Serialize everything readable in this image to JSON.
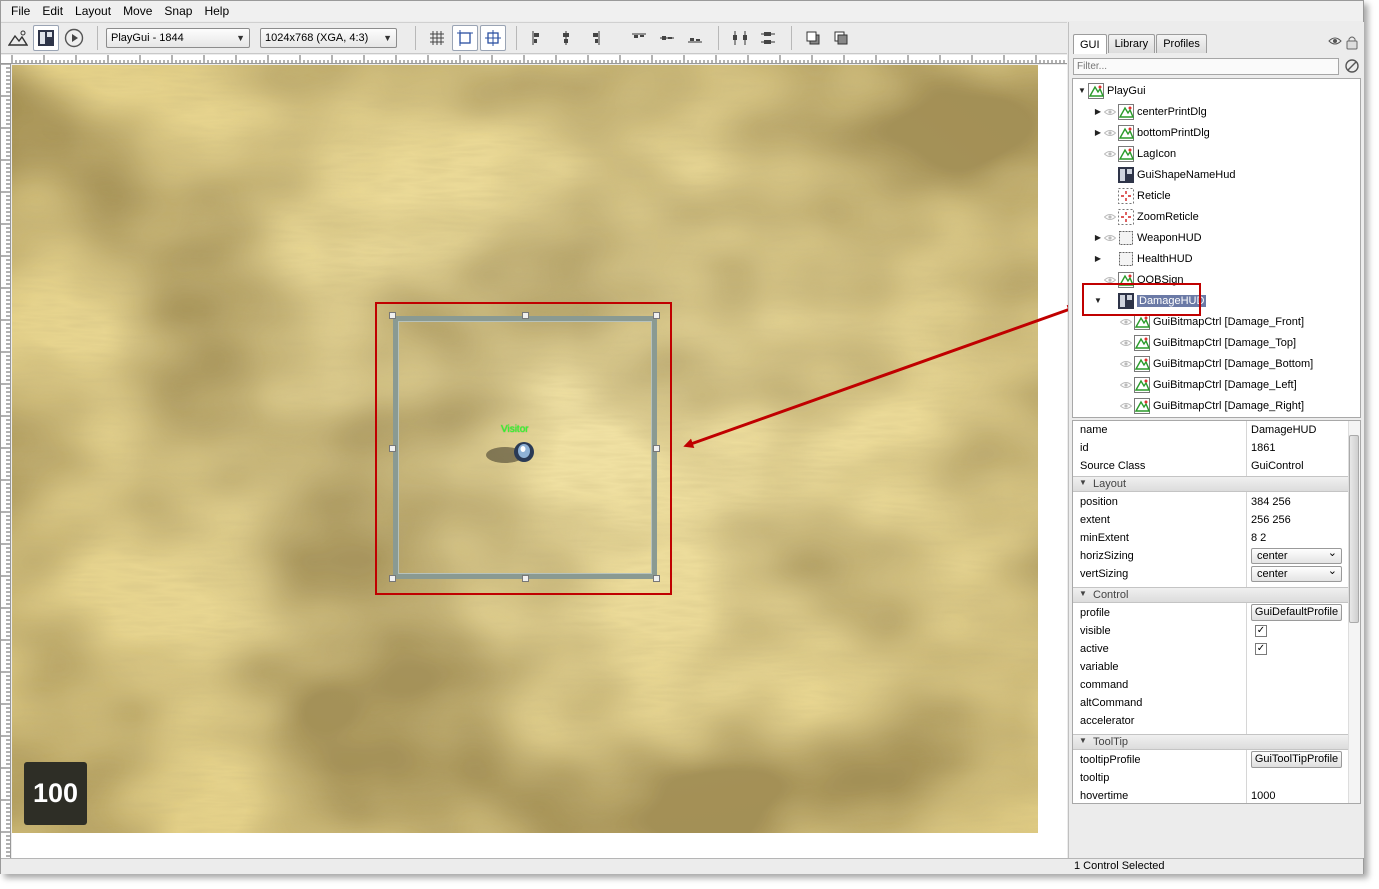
{
  "menubar": {
    "items": [
      "File",
      "Edit",
      "Layout",
      "Move",
      "Snap",
      "Help"
    ]
  },
  "toolbar": {
    "gui_select": "PlayGui - 1844",
    "resolution_select": "1024x768 (XGA, 4:3)"
  },
  "canvas": {
    "object_label": "Visitor",
    "counter": "100"
  },
  "side_panel": {
    "tabs": [
      "GUI",
      "Library",
      "Profiles"
    ],
    "filter_placeholder": "Filter..."
  },
  "tree": [
    {
      "label": "PlayGui",
      "icon": "bitmap-icon",
      "depth": 0,
      "expander": "open",
      "eye": false
    },
    {
      "label": "centerPrintDlg",
      "icon": "bitmap-icon",
      "depth": 1,
      "expander": "closed",
      "eye": true
    },
    {
      "label": "bottomPrintDlg",
      "icon": "bitmap-icon",
      "depth": 1,
      "expander": "closed",
      "eye": true
    },
    {
      "label": "LagIcon",
      "icon": "bitmap-icon",
      "depth": 1,
      "expander": "none",
      "eye": true
    },
    {
      "label": "GuiShapeNameHud",
      "icon": "container-icon",
      "depth": 1,
      "expander": "none",
      "eye": false
    },
    {
      "label": "Reticle",
      "icon": "crosshair-icon",
      "depth": 1,
      "expander": "none",
      "eye": false
    },
    {
      "label": "ZoomReticle",
      "icon": "crosshair-icon",
      "depth": 1,
      "expander": "none",
      "eye": true
    },
    {
      "label": "WeaponHUD",
      "icon": "frame-icon",
      "depth": 1,
      "expander": "closed",
      "eye": true
    },
    {
      "label": "HealthHUD",
      "icon": "frame-icon",
      "depth": 1,
      "expander": "closed",
      "eye": false
    },
    {
      "label": "OOBSign",
      "icon": "bitmap-icon",
      "depth": 1,
      "expander": "none",
      "eye": true
    },
    {
      "label": "DamageHUD",
      "icon": "container-icon",
      "depth": 1,
      "expander": "open",
      "eye": false,
      "selected": true
    },
    {
      "label": "GuiBitmapCtrl [Damage_Front]",
      "icon": "bitmap-icon",
      "depth": 2,
      "expander": "none",
      "eye": true
    },
    {
      "label": "GuiBitmapCtrl [Damage_Top]",
      "icon": "bitmap-icon",
      "depth": 2,
      "expander": "none",
      "eye": true
    },
    {
      "label": "GuiBitmapCtrl [Damage_Bottom]",
      "icon": "bitmap-icon",
      "depth": 2,
      "expander": "none",
      "eye": true
    },
    {
      "label": "GuiBitmapCtrl [Damage_Left]",
      "icon": "bitmap-icon",
      "depth": 2,
      "expander": "none",
      "eye": true
    },
    {
      "label": "GuiBitmapCtrl [Damage_Right]",
      "icon": "bitmap-icon",
      "depth": 2,
      "expander": "none",
      "eye": true
    }
  ],
  "inspector": {
    "name": {
      "label": "name",
      "value": "DamageHUD"
    },
    "id": {
      "label": "id",
      "value": "1861"
    },
    "source_class": {
      "label": "Source Class",
      "value": "GuiControl"
    },
    "layout_title": "Layout",
    "position": {
      "label": "position",
      "value": "384 256"
    },
    "extent": {
      "label": "extent",
      "value": "256 256"
    },
    "min_extent": {
      "label": "minExtent",
      "value": "8 2"
    },
    "horiz_sizing": {
      "label": "horizSizing",
      "value": "center"
    },
    "vert_sizing": {
      "label": "vertSizing",
      "value": "center"
    },
    "control_title": "Control",
    "profile": {
      "label": "profile",
      "value": "GuiDefaultProfile"
    },
    "visible": {
      "label": "visible",
      "value": "✓"
    },
    "active": {
      "label": "active",
      "value": "✓"
    },
    "variable": {
      "label": "variable"
    },
    "command": {
      "label": "command"
    },
    "alt_command": {
      "label": "altCommand"
    },
    "accelerator": {
      "label": "accelerator"
    },
    "tooltip_title": "ToolTip",
    "tooltip_profile": {
      "label": "tooltipProfile",
      "value": "GuiToolTipProfile"
    },
    "tooltip": {
      "label": "tooltip"
    },
    "hovertime": {
      "label": "hovertime",
      "value": "1000"
    }
  },
  "status": {
    "text": "1 Control Selected"
  },
  "colors": {
    "selection": "#c00000",
    "label_green": "#31ff31",
    "tree_selected": "#6b7aa6"
  }
}
